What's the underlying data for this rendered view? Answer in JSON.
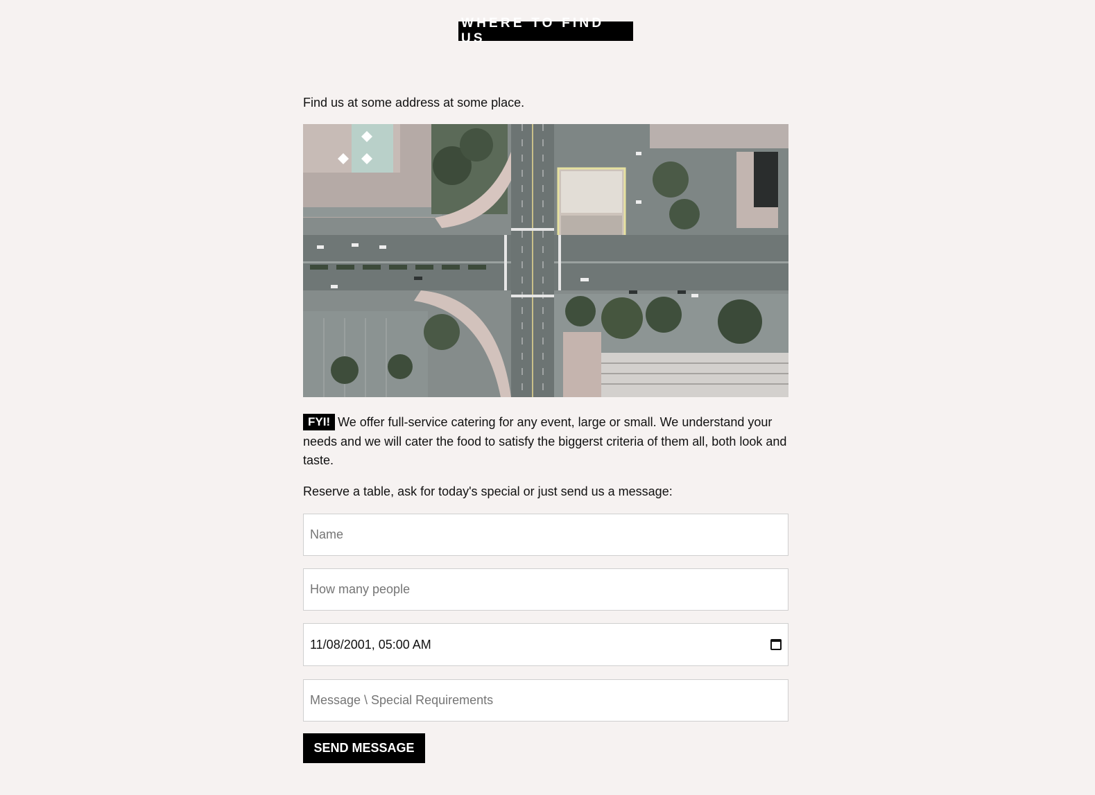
{
  "header": {
    "title": "WHERE TO FIND US"
  },
  "location": {
    "address_text": "Find us at some address at some place."
  },
  "info": {
    "tag": "FYI!",
    "text": "We offer full-service catering for any event, large or small. We understand your needs and we will cater the food to satisfy the biggerst criteria of them all, both look and taste."
  },
  "reserve": {
    "intro": "Reserve a table, ask for today's special or just send us a message:"
  },
  "form": {
    "name_placeholder": "Name",
    "people_placeholder": "How many people",
    "datetime_value": "11/08/2001, 05:00 AM",
    "message_placeholder": "Message \\ Special Requirements",
    "submit_label": "SEND MESSAGE"
  },
  "icons": {
    "datetime": "calendar-icon"
  },
  "colors": {
    "background": "#f6f2f1",
    "accent": "#000000",
    "field_border": "#cfcfcf"
  }
}
